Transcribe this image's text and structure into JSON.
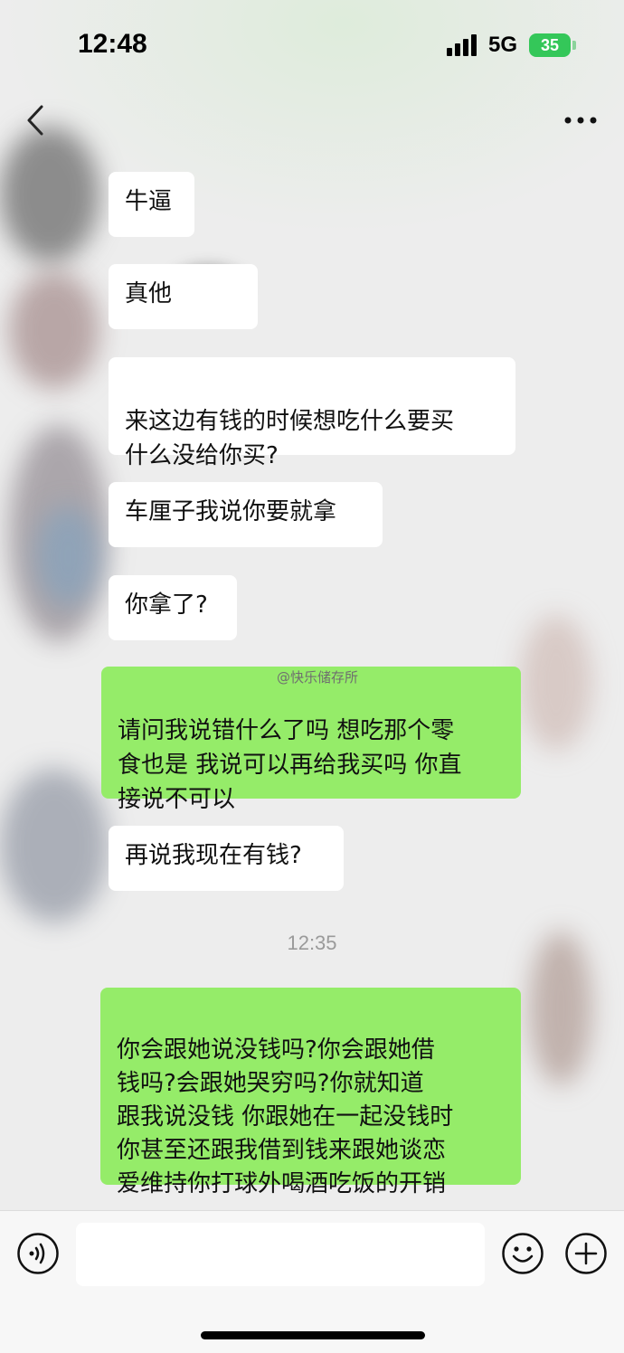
{
  "status_bar": {
    "time": "12:48",
    "network": "5G",
    "battery": "35"
  },
  "nav": {
    "back_icon": "chevron-left-icon",
    "more_icon": "more-dots-icon"
  },
  "messages": [
    {
      "side": "incoming",
      "text": "牛逼"
    },
    {
      "side": "incoming",
      "text": "真他"
    },
    {
      "side": "incoming",
      "text": "来这边有钱的时候想吃什么要买\n什么没给你买?"
    },
    {
      "side": "incoming",
      "text": "车厘子我说你要就拿"
    },
    {
      "side": "incoming",
      "text": "你拿了?"
    },
    {
      "side": "outgoing",
      "text": "请问我说错什么了吗 想吃那个零\n食也是 我说可以再给我买吗 你直\n接说不可以"
    },
    {
      "side": "incoming",
      "text": "再说我现在有钱?"
    },
    {
      "side": "outgoing",
      "text": "你会跟她说没钱吗?你会跟她借\n钱吗?会跟她哭穷吗?你就知道\n跟我说没钱 你跟她在一起没钱时\n你甚至还跟我借到钱来跟她谈恋\n爱维持你打球外喝酒吃饭的开销"
    }
  ],
  "timestamp": "12:35",
  "watermark": "@快乐储存所",
  "input_bar": {
    "voice_icon": "voice-icon",
    "emoji_icon": "emoji-icon",
    "plus_icon": "plus-icon",
    "text_value": ""
  },
  "colors": {
    "background": "#ededed",
    "incoming_bubble": "#ffffff",
    "outgoing_bubble": "#95ec69",
    "battery": "#34c759"
  }
}
